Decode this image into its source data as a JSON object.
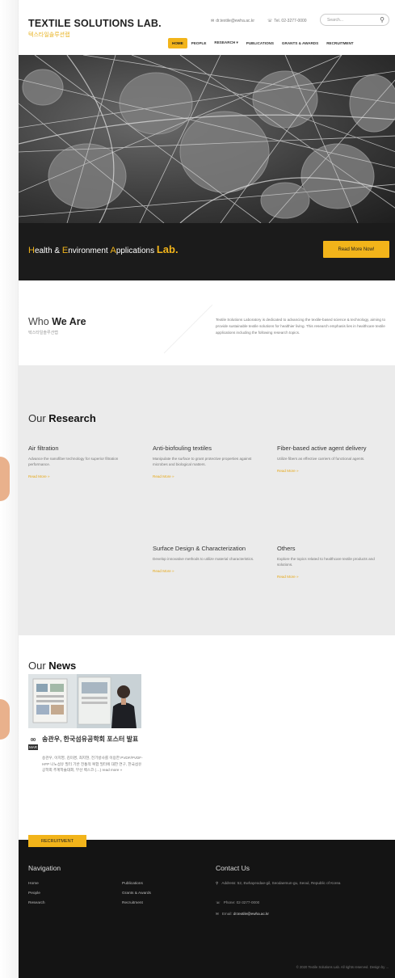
{
  "header": {
    "title": "TEXTILE SOLUTIONS LAB.",
    "subtitle": "텍스타일솔루션랩",
    "email": "dr.textile@ewha.ac.kr",
    "phone": "Tel. 02-3277-0000",
    "search_placeholder": "Search..."
  },
  "nav": {
    "items": [
      "HOME",
      "PEOPLE",
      "RESEARCH ▾",
      "PUBLICATIONS",
      "GRANTS & AWARDS",
      "RECRUITMENT"
    ]
  },
  "hero": {
    "tagline_caps": [
      "H",
      "E",
      "A"
    ],
    "tagline_parts": [
      "ealth & ",
      "nvironment ",
      "pplications "
    ],
    "tagline_lab": "Lab.",
    "cta_label": "Read More Now!"
  },
  "who": {
    "title_light": "Who ",
    "title_bold": "We Are",
    "subtitle": "텍스타일솔루션랩",
    "text": "Textile Solutions Laboratory is dedicated to advancing the textile-based science & technology, aiming to provide sustainable textile solutions for healthier living. This research emphasis lies in healthcare textile applications including the following research topics."
  },
  "research": {
    "title_light": "Our ",
    "title_bold": "Research",
    "read_more": "Read More »",
    "items": [
      {
        "title": "Air filtration",
        "desc": "Advance the nanofiber technology for superior filtration performance."
      },
      {
        "title": "Anti-biofouling textiles",
        "desc": "Manipulate the surface to grant protective properties against microbes and biological matters."
      },
      {
        "title": "Fiber-based active agent delivery",
        "desc": "Utilize fibers as effective carriers of functional agents."
      },
      {
        "title": "Surface Design & Characterization",
        "desc": "Develop innovative methods to utilize material characteristics."
      },
      {
        "title": "Others",
        "desc": "Explore the topics related to healthcare textile products and solutions."
      }
    ]
  },
  "news": {
    "title_light": "Our ",
    "title_bold": "News",
    "date_day": "00",
    "date_month": "MAR",
    "item_title": "송관우, 한국섬유공학회 포스터 발표",
    "item_excerpt": "송관우, 이지영, 김미경, 최지현, 전기방사를 이용한 PVDF/PVDF-HFP 나노섬유 필터 기반 전통적 복합 필터에 대한 연구, 한국섬유공학회 추계학술대회, 부산 벡스코 (…) read more »"
  },
  "footer": {
    "recruit_label": "RECRUITMENT",
    "nav_title": "Navigation",
    "contact_title": "Contact Us",
    "links_col1": [
      "Home",
      "People",
      "Research"
    ],
    "links_col2": [
      "Publications",
      "Grants & Awards",
      "Recruitment"
    ],
    "address": "Address: 52, Ewhayeodae-gil, Seodaemun-gu, Seoul, Republic of Korea",
    "phone": "Phone: 02-3277-0000",
    "email_label": "Email: ",
    "email": "dr.textile@ewha.ac.kr",
    "copyright": "© 2020 Textile Solutions Lab. All rights reserved. Design by ..."
  },
  "colors": {
    "accent": "#f2b41a",
    "dark": "#1b1b1b",
    "research_bg": "#ebebeb"
  }
}
